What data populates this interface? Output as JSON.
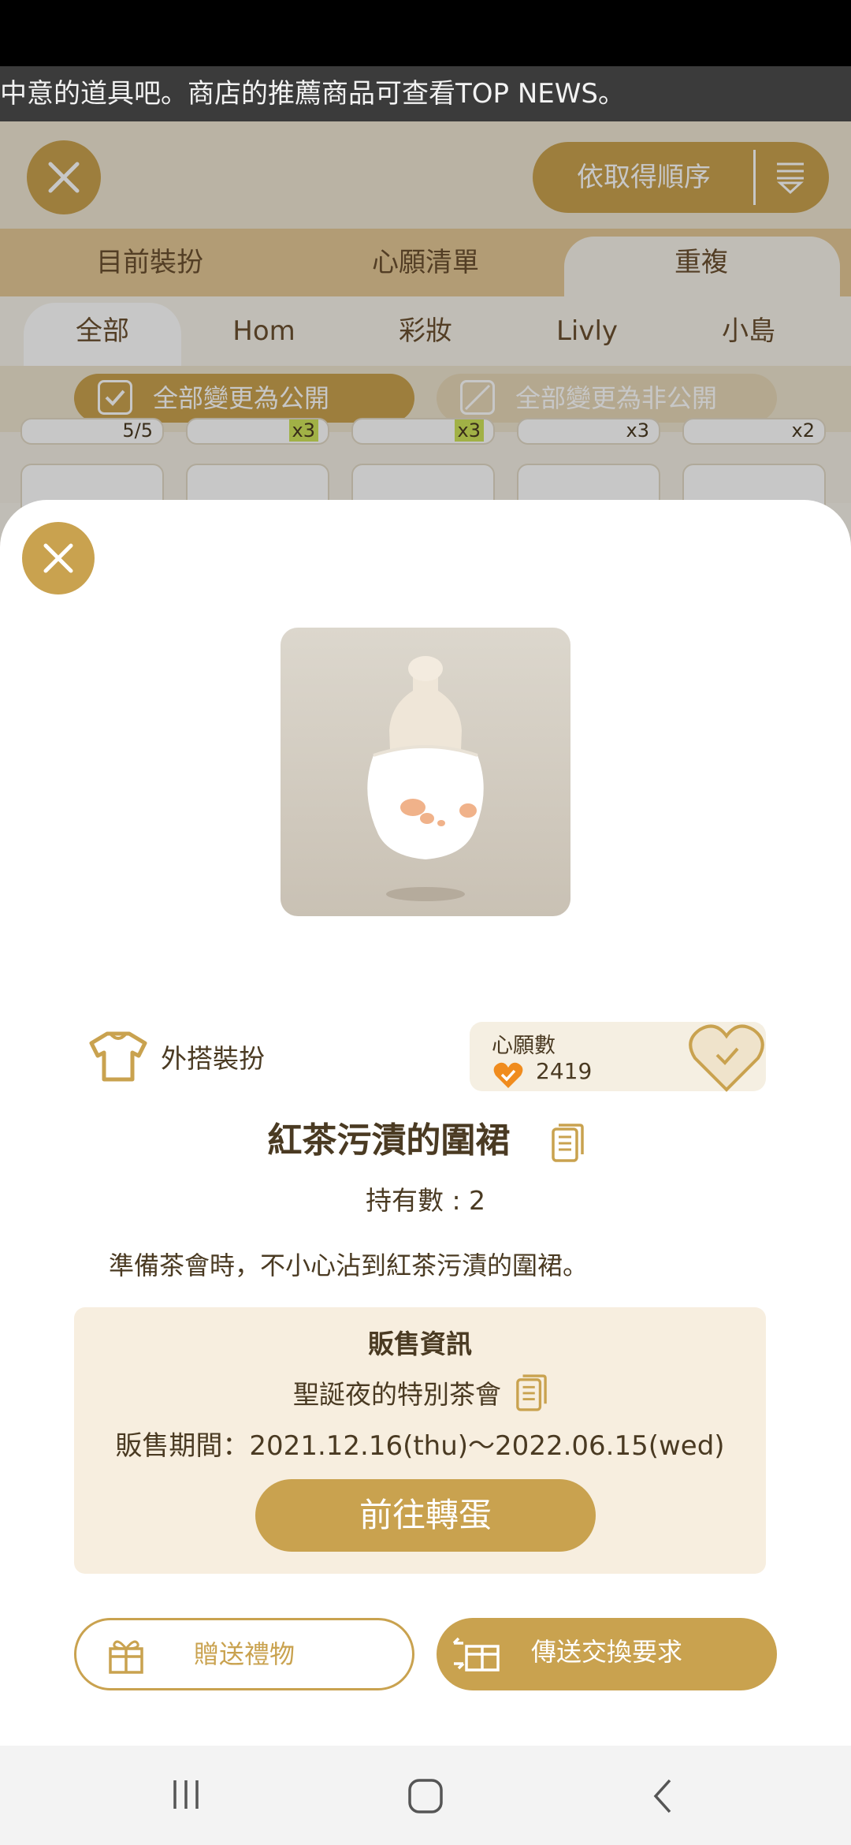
{
  "ticker": {
    "text": "中意的道具吧。商店的推薦商品可查看TOP NEWS。"
  },
  "toolbar": {
    "sort_label": "依取得順序",
    "close_icon": "close-icon",
    "sort_icon": "sort-icon"
  },
  "main_tabs": [
    {
      "label": "目前裝扮"
    },
    {
      "label": "心願清單"
    },
    {
      "label": "重複",
      "selected": true
    }
  ],
  "sub_tabs": [
    {
      "label": "全部",
      "selected": true
    },
    {
      "label": "Hom"
    },
    {
      "label": "彩妝"
    },
    {
      "label": "Livly"
    },
    {
      "label": "小島"
    }
  ],
  "visibility": {
    "public_label": "全部變更為公開",
    "private_label": "全部變更為非公開"
  },
  "grid_counts": [
    "5/5",
    "x3",
    "x3",
    "x3",
    "x2"
  ],
  "modal": {
    "category": "外搭裝扮",
    "wish_title": "心願數",
    "wish_count": "2419",
    "item_name": "紅茶污漬的圍裙",
    "owned": "持有數 : 2",
    "description": "準備茶會時，不小心沾到紅茶污漬的圍裙。",
    "sale_header": "販售資訊",
    "gacha_name": "聖誕夜的特別茶會",
    "sale_period": "販售期間：2021.12.16(thu)～2022.06.15(wed)",
    "goto_gacha": "前往轉蛋",
    "gift_label": "贈送禮物",
    "trade_label": "傳送交換要求"
  },
  "colors": {
    "accent": "#c9a24f",
    "text": "#4a3a22",
    "panel": "#f7eedf"
  }
}
